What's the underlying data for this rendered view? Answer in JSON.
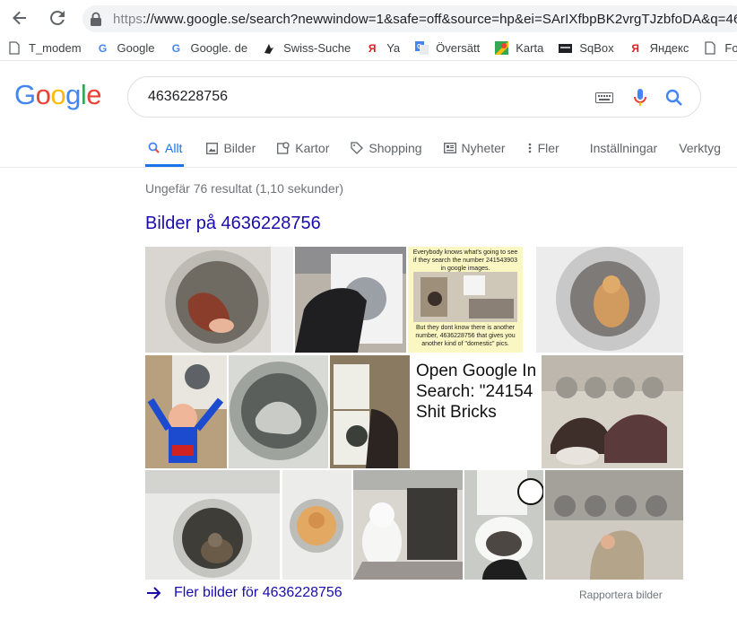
{
  "browser": {
    "url_protocol": "https",
    "url_rest": "://www.google.se/search?newwindow=1&safe=off&source=hp&ei=SArIXfbpBK2vrgTJzbfoDA&q=46"
  },
  "bookmarks": [
    {
      "label": "T_modem",
      "icon": "page-icon"
    },
    {
      "label": "Google",
      "icon": "google-g-icon"
    },
    {
      "label": "Google. de",
      "icon": "google-g-icon"
    },
    {
      "label": "Swiss-Suche",
      "icon": "swiss-icon"
    },
    {
      "label": "Ya",
      "icon": "yandex-icon"
    },
    {
      "label": "Översätt",
      "icon": "translate-icon"
    },
    {
      "label": "Karta",
      "icon": "maps-icon"
    },
    {
      "label": "SqBox",
      "icon": "sqbox-icon"
    },
    {
      "label": "Яндекс",
      "icon": "yandex-icon"
    },
    {
      "label": "For",
      "icon": "page-icon"
    }
  ],
  "logo": "Google",
  "search": {
    "query": "4636228756"
  },
  "tabs": [
    {
      "label": "Allt",
      "icon": "search-icon",
      "active": true
    },
    {
      "label": "Bilder",
      "icon": "image-icon"
    },
    {
      "label": "Kartor",
      "icon": "map-icon"
    },
    {
      "label": "Shopping",
      "icon": "tag-icon"
    },
    {
      "label": "Nyheter",
      "icon": "news-icon"
    },
    {
      "label": "Fler",
      "icon": "more-vert-icon"
    },
    {
      "label": "Inställningar"
    },
    {
      "label": "Verktyg"
    }
  ],
  "stats": "Ungefär 76 resultat (1,10 sekunder)",
  "images_section": {
    "title": "Bilder på 4636228756",
    "meme_top_text": "Everybody knows what's going to see if they search the number 241543903 in google images.",
    "meme_bottom_text": "But they dont know there is another number, 4636228756 that gives you another kind of \"domestic\" pics.",
    "open_google_text_1": "Open Google In",
    "open_google_text_2": "Search: \"24154",
    "open_google_text_3": "Shit Bricks",
    "more_link": "Fler bilder för 4636228756",
    "report": "Rapportera bilder"
  }
}
